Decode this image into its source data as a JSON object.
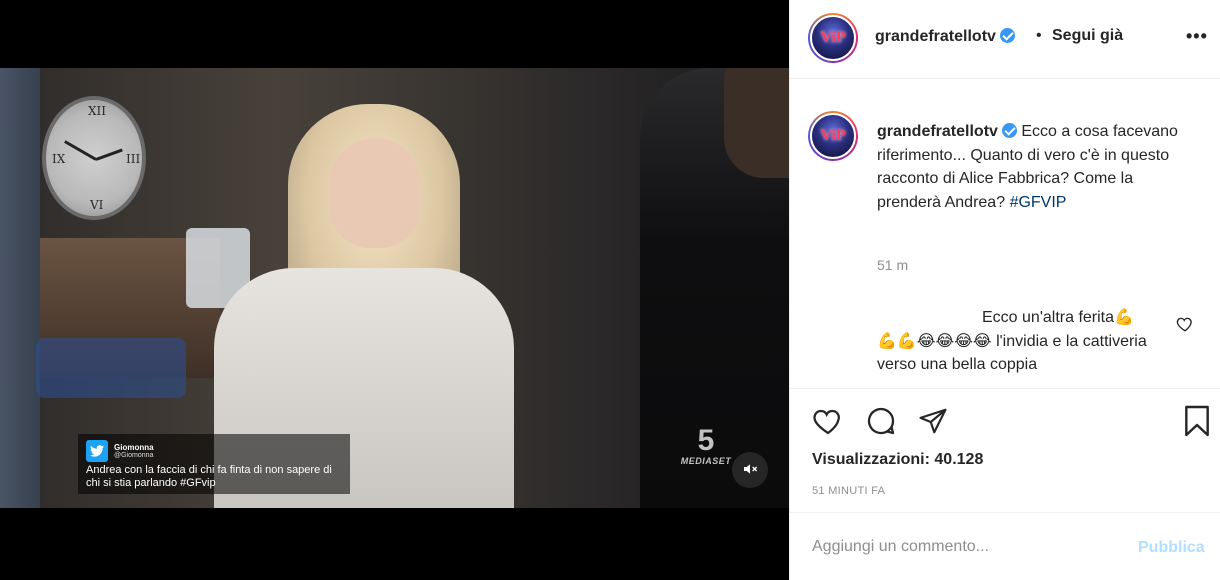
{
  "post": {
    "username": "grandefratellotv",
    "verified": true,
    "follow_separator": "•",
    "follow_label": "Segui già",
    "more_label": "•••",
    "avatar_text": "ViP"
  },
  "video": {
    "tweet": {
      "name": "Giomonna",
      "handle": "@Giomonna",
      "text": "Andrea con la faccia di chi fa finta di non sapere di chi si stia parlando #GFvip"
    },
    "channel_logo": "5",
    "channel_name": "MEDIASET",
    "mute_icon": "speaker-muted-icon"
  },
  "caption": {
    "username": "grandefratellotv",
    "text": "Ecco a cosa facevano riferimento... Quanto di vero c'è in questo racconto di Alice Fabbrica? Come la prenderà Andrea?",
    "hashtag": "#GFVIP",
    "time": "51 m"
  },
  "comment": {
    "line1": "Ecco un'altra ferita💪",
    "line2": "💪💪😂😂😂😂 l'invidia e la cattiveria verso una bella coppia"
  },
  "actions": {
    "views_label": "Visualizzazioni: 40.128",
    "time_ago": "51 MINUTI FA"
  },
  "add_comment": {
    "placeholder": "Aggiungi un commento...",
    "publish_label": "Pubblica"
  },
  "colors": {
    "link": "#00376b",
    "verified": "#3897f0",
    "publish_disabled": "#b2dffc",
    "muted_text": "#8e8e8e"
  }
}
